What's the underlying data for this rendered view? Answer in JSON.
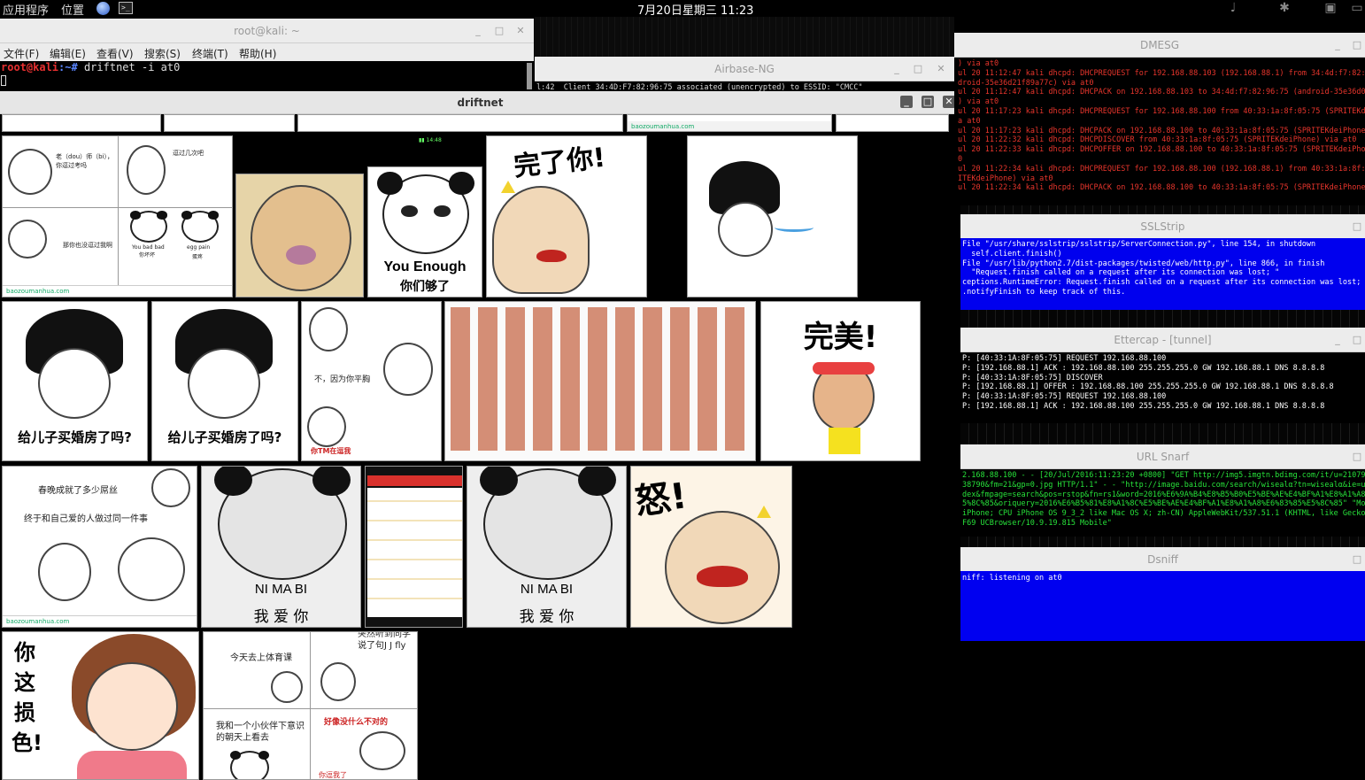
{
  "panel": {
    "applications": "应用程序",
    "places": "位置",
    "clock": "7月20日星期三 11:23"
  },
  "icons": [
    "globe-icon",
    "terminal-icon",
    "volume-muted-icon",
    "bluetooth-icon",
    "network-icon",
    "chat-icon"
  ],
  "terminal": {
    "title": "root@kali: ~",
    "menus": [
      "文件(F)",
      "编辑(E)",
      "查看(V)",
      "搜索(S)",
      "终端(T)",
      "帮助(H)"
    ],
    "prompt_user": "root@kali",
    "prompt_path": ":~#",
    "command": " driftnet -i at0"
  },
  "airbase": {
    "title": "Airbase-NG",
    "line": "l:42  Client 34:4D:F7:82:96:75 associated (unencrypted) to ESSID: \"CMCC\""
  },
  "driftnet": {
    "title": "driftnet",
    "tiles": {
      "meme1_top": "老（dou）师（bi），你逗过考吗",
      "meme1_top2": "逗过几次吧",
      "meme1_mid": "那你也没逗过我啊",
      "meme1_caption_a": "You bad bad",
      "meme1_caption_b": "你坏坏",
      "meme1_caption_c": "egg pain",
      "meme1_caption_d": "蛋疼",
      "site": "baozoumanhua.com",
      "you_enough_en": "You Enough",
      "you_enough_cn": "你们够了",
      "wanle": "完了你!",
      "house": "给儿子买婚房了吗?",
      "ping": "不，因为你平胸",
      "ni_tm": "你TM在逗我",
      "wanmei": "完美!",
      "spring_1": "春晚成就了多少屌丝",
      "spring_2": "终于和自己爱的人做过同一件事",
      "nimabi": "NI  MA  BI",
      "woaini": "我  爱  你",
      "nu": "怒!",
      "nizhe": "你这损色!",
      "pe_1": "今天去上体育课",
      "pe_2": "突然听到同学说了句J J fly",
      "pe_3": "我和一个小伙伴下意识的朝天上看去",
      "pe_4": "好像没什么不对的",
      "pe_5": "你逗我了"
    }
  },
  "dmesg": {
    "title": "DMESG",
    "lines": [
      ") via at0",
      "ul 20 11:12:47 kali dhcpd: DHCPREQUEST for 192.168.88.103 (192.168.88.1) from 34:4d:f7:82:96",
      "droid-35e36d21f89a77c) via at0",
      "ul 20 11:12:47 kali dhcpd: DHCPACK on 192.168.88.103 to 34:4d:f7:82:96:75 (android-35e36d021",
      ") via at0",
      "ul 20 11:17:23 kali dhcpd: DHCPREQUEST for 192.168.88.100 from 40:33:1a:8f:05:75 (SPRITEKdei",
      "a at0",
      "ul 20 11:17:23 kali dhcpd: DHCPACK on 192.168.88.100 to 40:33:1a:8f:05:75 (SPRITEKdeiPhone)",
      "ul 20 11:22:32 kali dhcpd: DHCPDISCOVER from 40:33:1a:8f:05:75 (SPRITEKdeiPhone) via at0",
      "ul 20 11:22:33 kali dhcpd: DHCPOFFER on 192.168.88.100 to 40:33:1a:8f:05:75 (SPRITEKdeiPhone",
      "0",
      "ul 20 11:22:34 kali dhcpd: DHCPREQUEST for 192.168.88.100 (192.168.88.1) from 40:33:1a:8f:05",
      "ITEKdeiPhone) via at0",
      "ul 20 11:22:34 kali dhcpd: DHCPACK on 192.168.88.100 to 40:33:1a:8f:05:75 (SPRITEKdeiPhone)"
    ]
  },
  "sslstrip": {
    "title": "SSLStrip",
    "lines": [
      "File \"/usr/share/sslstrip/sslstrip/ServerConnection.py\", line 154, in shutdown",
      "  self.client.finish()",
      "File \"/usr/lib/python2.7/dist-packages/twisted/web/http.py\", line 866, in finish",
      "  \"Request.finish called on a request after its connection was lost; \"",
      "ceptions.RuntimeError: Request.finish called on a request after its connection was lost; use",
      ".notifyFinish to keep track of this."
    ]
  },
  "ettercap": {
    "title": "Ettercap - [tunnel]",
    "lines": [
      "P: [40:33:1A:8F:05:75] REQUEST 192.168.88.100",
      "P: [192.168.88.1] ACK : 192.168.88.100 255.255.255.0 GW 192.168.88.1 DNS 8.8.8.8",
      "P: [40:33:1A:8F:05:75] DISCOVER",
      "P: [192.168.88.1] OFFER : 192.168.88.100 255.255.255.0 GW 192.168.88.1 DNS 8.8.8.8",
      "P: [40:33:1A:8F:05:75] REQUEST 192.168.88.100",
      "P: [192.168.88.1] ACK : 192.168.88.100 255.255.255.0 GW 192.168.88.1 DNS 8.8.8.8"
    ]
  },
  "urlsnarf": {
    "title": "URL Snarf",
    "lines": [
      "2.168.88.100 - - [20/Jul/2016:11:23:20 +0800] \"GET http://img5.imgtn.bdimg.com/it/u=21079614",
      "38790&fm=21&gp=0.jpg HTTP/1.1\" - - \"http://image.baidu.com/search/wisealα?tn=wisealα&ie=utf8",
      "dex&fmpage=search&pos=rstop&fn=rs1&word=2016%E6%9A%B4%E8%B5%B0%E5%BE%AE%E4%BF%A1%E8%A1%A8%E6",
      "5%8C%85&oriquery=2016%E6%B5%81%E8%A1%8C%E5%BE%AE%E4%BF%A1%E8%A1%A8%E6%83%85%E5%8C%85\" \"Mozil",
      "iPhone; CPU iPhone OS 9_3_2 like Mac OS X; zh-CN) AppleWebKit/537.51.1 (KHTML, like Gecko) M",
      "F69 UCBrowser/10.9.19.815 Mobile\""
    ]
  },
  "dsniff": {
    "title": "Dsniff",
    "line": "niff: listening on at0"
  },
  "colors": {
    "dmesg_text": "#e8352c",
    "ssl_bg": "#0000ee",
    "dsniff_bg": "#0000f0",
    "ettercap_text": "#ffffff",
    "urlsnarf_text": "#27e23a"
  }
}
